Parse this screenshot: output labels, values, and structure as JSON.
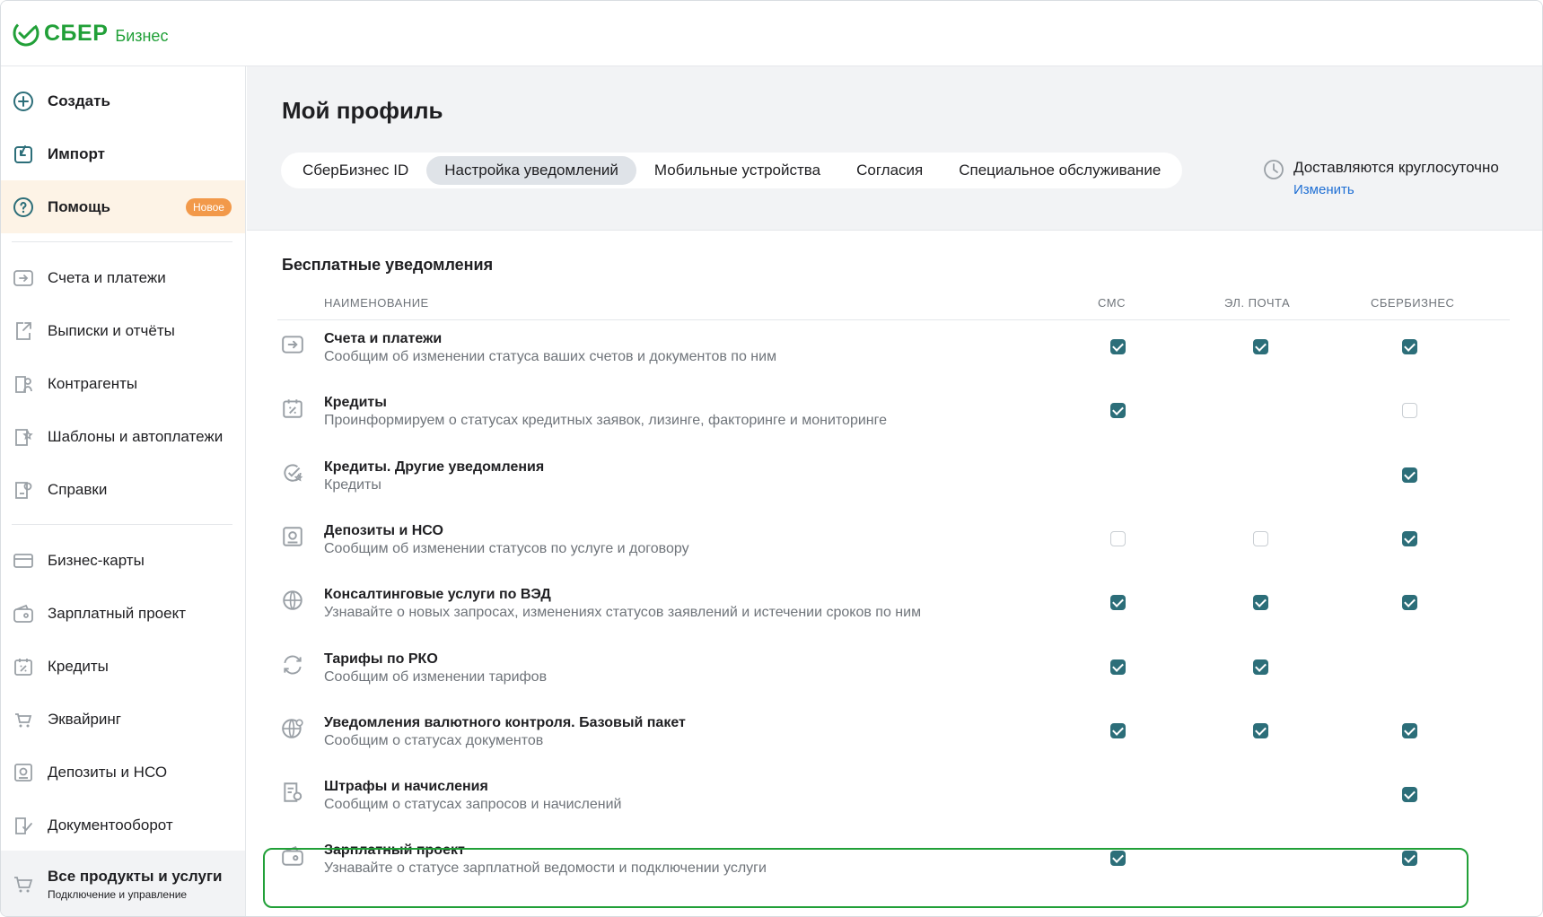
{
  "brand": {
    "name": "СБЕР",
    "sub": "Бизнес",
    "accent": "#21a038"
  },
  "sidebar": {
    "top_items": [
      {
        "label": "Создать",
        "icon": "plus-circle-icon"
      },
      {
        "label": "Импорт",
        "icon": "import-icon"
      },
      {
        "label": "Помощь",
        "icon": "help-icon",
        "badge": "Новое"
      }
    ],
    "items": [
      {
        "label": "Счета и платежи",
        "icon": "payments-icon"
      },
      {
        "label": "Выписки и отчёты",
        "icon": "statements-icon"
      },
      {
        "label": "Контрагенты",
        "icon": "contractors-icon"
      },
      {
        "label": "Шаблоны и автоплатежи",
        "icon": "templates-icon"
      },
      {
        "label": "Справки",
        "icon": "certificates-icon"
      },
      {
        "label": "Бизнес-карты",
        "icon": "card-icon"
      },
      {
        "label": "Зарплатный проект",
        "icon": "wallet-icon"
      },
      {
        "label": "Кредиты",
        "icon": "credit-icon"
      },
      {
        "label": "Эквайринг",
        "icon": "acquiring-icon"
      },
      {
        "label": "Депозиты и НСО",
        "icon": "deposit-icon"
      },
      {
        "label": "Документооборот",
        "icon": "documents-icon"
      }
    ],
    "all_products": {
      "title": "Все продукты и услуги",
      "subtitle": "Подключение и управление"
    }
  },
  "page": {
    "title": "Мой профиль",
    "tabs": [
      "СберБизнес ID",
      "Настройка уведомлений",
      "Мобильные устройства",
      "Согласия",
      "Специальное обслуживание"
    ],
    "active_tab": "Настройка уведомлений",
    "delivery": {
      "text": "Доставляются круглосуточно",
      "link": "Изменить"
    }
  },
  "notifications": {
    "section_title": "Бесплатные уведомления",
    "columns": {
      "name": "НАИМЕНОВАНИЕ",
      "sms": "СМС",
      "email": "ЭЛ. ПОЧТА",
      "sberbusiness": "СБЕРБИЗНЕС"
    },
    "rows": [
      {
        "title": "Счета и платежи",
        "subtitle": "Сообщим об изменении статуса ваших счетов и документов по ним",
        "icon": "payments-icon",
        "sms": true,
        "email": true,
        "sb": true
      },
      {
        "title": "Кредиты",
        "subtitle": "Проинформируем о статусах кредитных заявок, лизинге, факторинге и мониторинге",
        "icon": "credit-icon",
        "sms": true,
        "email": null,
        "sb": false
      },
      {
        "title": "Кредиты. Другие уведомления",
        "subtitle": "Кредиты",
        "icon": "credit-other-icon",
        "sms": null,
        "email": null,
        "sb": true
      },
      {
        "title": "Депозиты и НСО",
        "subtitle": "Сообщим об изменении статусов по услуге и договору",
        "icon": "deposit-icon",
        "sms": false,
        "email": false,
        "sb": true
      },
      {
        "title": "Консалтинговые услуги по ВЭД",
        "subtitle": "Узнавайте о новых запросах, изменениях статусов заявлений и истечении сроков по ним",
        "icon": "globe-icon",
        "sms": true,
        "email": true,
        "sb": true
      },
      {
        "title": "Тарифы по РКО",
        "subtitle": "Сообщим об изменении тарифов",
        "icon": "tariff-icon",
        "sms": true,
        "email": true,
        "sb": null
      },
      {
        "title": "Уведомления валютного контроля. Базовый пакет",
        "subtitle": "Сообщим о статусах документов",
        "icon": "currency-globe-icon",
        "sms": true,
        "email": true,
        "sb": true
      },
      {
        "title": "Штрафы и начисления",
        "subtitle": "Сообщим о статусах запросов и начислений",
        "icon": "fines-icon",
        "sms": null,
        "email": null,
        "sb": true
      },
      {
        "title": "Зарплатный проект",
        "subtitle": "Узнавайте о статусе зарплатной ведомости и подключении услуги",
        "icon": "wallet-icon",
        "sms": true,
        "email": null,
        "sb": true
      }
    ]
  }
}
